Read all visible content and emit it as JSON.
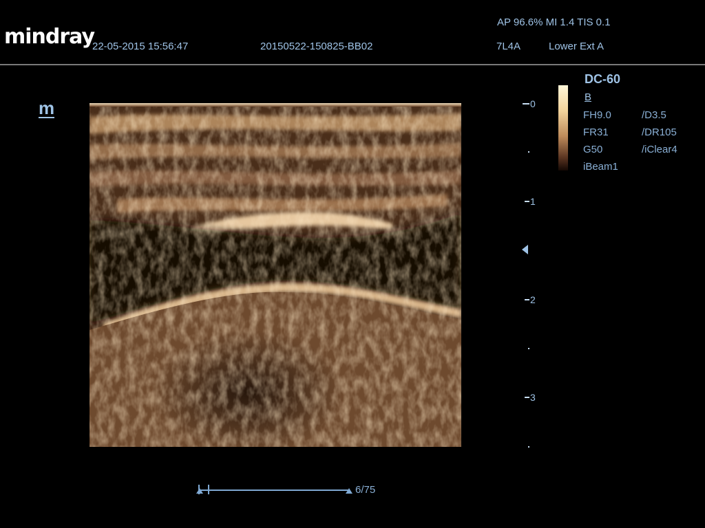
{
  "header": {
    "brand": "mindray",
    "datetime": "22-05-2015 15:56:47",
    "exam_id": "20150522-150825-BB02",
    "acoustic": "AP 96.6%  MI 1.4 TIS 0.1",
    "probe": "7L4A",
    "exam_preset": "Lower Ext A"
  },
  "side": {
    "mode_icon": "m"
  },
  "depth_scale": {
    "labels": [
      "0",
      "1",
      "2",
      "3"
    ],
    "focus_marker_icon": "triangle-left-icon"
  },
  "params": {
    "model": "DC-60",
    "mode": "B",
    "left": [
      "FH9.0",
      "FR31",
      "G50",
      "iBeam1"
    ],
    "right": [
      "/D3.5",
      "/DR105",
      "/iClear4"
    ]
  },
  "cine": {
    "frame": "6/75"
  },
  "colors": {
    "text": "#9fc3e6",
    "tissue_dark": "#241408",
    "tissue_bright": "#f0d2a8"
  }
}
